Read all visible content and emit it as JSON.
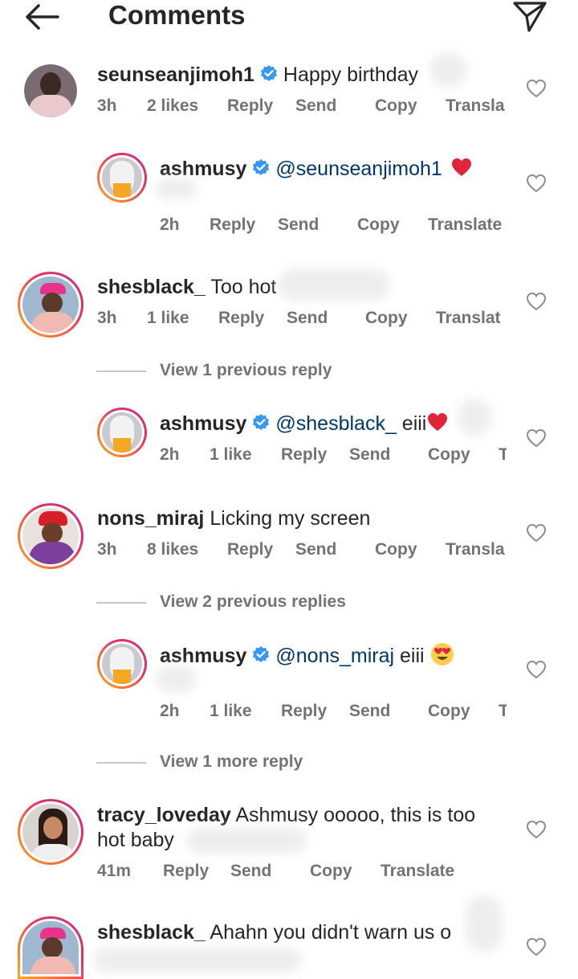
{
  "header": {
    "title": "Comments"
  },
  "colors": {
    "text": "#262626",
    "meta": "#737373",
    "mention": "#00376b",
    "verified": "#3897f0",
    "heart_emoji": "#e0243a"
  },
  "comments": [
    {
      "username": "seunseanjimoh1",
      "text": "Happy birthday",
      "meta": {
        "time": "3h",
        "likes": "2 likes",
        "reply": "Reply",
        "send": "Send",
        "copy": "Copy",
        "translate": "Transla"
      }
    },
    {
      "username": "ashmusy",
      "mention": "@seunseanjimoh1",
      "text": "",
      "meta": {
        "time": "2h",
        "reply": "Reply",
        "send": "Send",
        "copy": "Copy",
        "translate": "Translate"
      }
    },
    {
      "username": "shesblack_",
      "text": "Too hot",
      "meta": {
        "time": "3h",
        "likes": "1 like",
        "reply": "Reply",
        "send": "Send",
        "copy": "Copy",
        "translate": "Translat"
      }
    },
    {
      "username": "ashmusy",
      "mention": "@shesblack_",
      "text": "eiii",
      "meta": {
        "time": "2h",
        "likes": "1 like",
        "reply": "Reply",
        "send": "Send",
        "copy": "Copy",
        "translate": "T"
      }
    },
    {
      "username": "nons_miraj",
      "text": "Licking my screen",
      "meta": {
        "time": "3h",
        "likes": "8 likes",
        "reply": "Reply",
        "send": "Send",
        "copy": "Copy",
        "translate": "Transla"
      }
    },
    {
      "username": "ashmusy",
      "mention": "@nons_miraj",
      "text": "eiii",
      "meta": {
        "time": "2h",
        "likes": "1 like",
        "reply": "Reply",
        "send": "Send",
        "copy": "Copy",
        "translate": "T"
      }
    },
    {
      "username": "tracy_loveday",
      "text": "Ashmusy ooooo, this is too",
      "text2": "hot baby",
      "meta": {
        "time": "41m",
        "reply": "Reply",
        "send": "Send",
        "copy": "Copy",
        "translate": "Translate"
      }
    },
    {
      "username": "shesblack_",
      "text": "Ahahn you didn't warn us o"
    }
  ],
  "view_replies": [
    "View 1 previous reply",
    "View 2 previous replies",
    "View 1 more reply"
  ],
  "icons": {
    "back": "arrow-left-icon",
    "send": "paper-plane-icon",
    "like": "heart-outline-icon",
    "verified": "verified-badge-icon"
  }
}
